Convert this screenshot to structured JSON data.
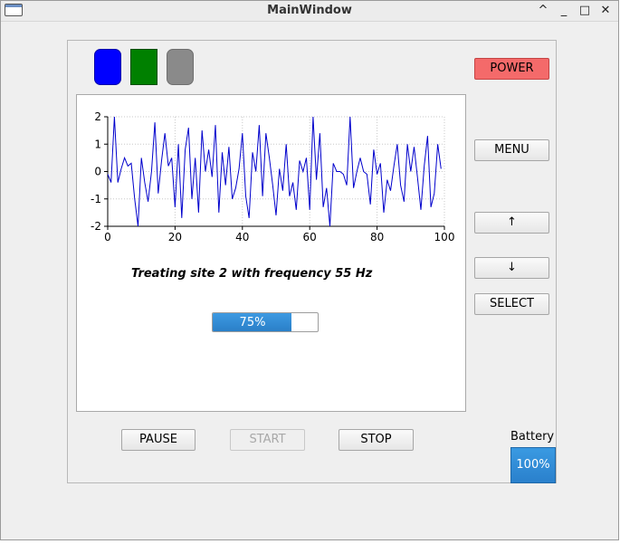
{
  "window": {
    "title": "MainWindow"
  },
  "titlebar_buttons": {
    "minimize_down": "^",
    "minimize": "_",
    "maximize": "□",
    "close": "✕"
  },
  "indicators": [
    {
      "name": "blue",
      "color": "#0000ff"
    },
    {
      "name": "green",
      "color": "#008000"
    },
    {
      "name": "gray",
      "color": "#8a8a8a"
    }
  ],
  "buttons": {
    "power": "POWER",
    "menu": "MENU",
    "up": "↑",
    "down": "↓",
    "select": "SELECT",
    "pause": "PAUSE",
    "start": "START",
    "stop": "STOP"
  },
  "status": {
    "treatment": "Treating site 2 with frequency 55 Hz",
    "progress_percent": 75,
    "progress_label": "75%"
  },
  "battery": {
    "label": "Battery",
    "value": "100%"
  },
  "chart_data": {
    "type": "line",
    "title": "",
    "xlabel": "",
    "ylabel": "",
    "xlim": [
      0,
      100
    ],
    "ylim": [
      -2,
      2
    ],
    "x_ticks": [
      "0",
      "20",
      "40",
      "60",
      "80",
      "100"
    ],
    "y_ticks": [
      "2",
      "1",
      "0",
      "-1",
      "-2"
    ],
    "grid": true,
    "line_color": "#0000cc",
    "series": [
      {
        "name": "",
        "x": [
          0,
          1,
          2,
          3,
          4,
          5,
          6,
          7,
          8,
          9,
          10,
          11,
          12,
          13,
          14,
          15,
          16,
          17,
          18,
          19,
          20,
          21,
          22,
          23,
          24,
          25,
          26,
          27,
          28,
          29,
          30,
          31,
          32,
          33,
          34,
          35,
          36,
          37,
          38,
          39,
          40,
          41,
          42,
          43,
          44,
          45,
          46,
          47,
          48,
          49,
          50,
          51,
          52,
          53,
          54,
          55,
          56,
          57,
          58,
          59,
          60,
          61,
          62,
          63,
          64,
          65,
          66,
          67,
          68,
          69,
          70,
          71,
          72,
          73,
          74,
          75,
          76,
          77,
          78,
          79,
          80,
          81,
          82,
          83,
          84,
          85,
          86,
          87,
          88,
          89,
          90,
          91,
          92,
          93,
          94,
          95,
          96,
          97,
          98,
          99
        ],
        "y": [
          -0.1,
          -0.4,
          2.0,
          -0.4,
          0.1,
          0.5,
          0.2,
          0.3,
          -1.0,
          -2.0,
          0.5,
          -0.4,
          -1.1,
          0.0,
          1.8,
          -0.8,
          0.4,
          1.4,
          0.2,
          0.5,
          -1.3,
          1.0,
          -1.7,
          0.8,
          1.6,
          -1.0,
          0.5,
          -1.5,
          1.5,
          0.0,
          0.8,
          -0.2,
          1.7,
          -1.5,
          0.7,
          -0.5,
          0.9,
          -1.0,
          -0.6,
          0.1,
          1.4,
          -0.9,
          -1.7,
          0.7,
          0.0,
          1.7,
          -0.9,
          1.4,
          0.5,
          -0.5,
          -1.6,
          0.1,
          -0.7,
          1.0,
          -0.9,
          -0.4,
          -1.4,
          0.4,
          0.0,
          0.5,
          -1.4,
          2.0,
          -0.3,
          1.4,
          -1.3,
          -0.6,
          -2.0,
          0.3,
          0.0,
          0.0,
          -0.1,
          -0.5,
          2.0,
          -0.6,
          0.0,
          0.5,
          0.0,
          -0.1,
          -1.2,
          0.8,
          -0.1,
          0.3,
          -1.5,
          -0.3,
          -0.7,
          0.2,
          1.0,
          -0.5,
          -1.1,
          1.0,
          0.0,
          0.9,
          -0.2,
          -1.4,
          0.2,
          1.3,
          -1.3,
          -0.8,
          1.0,
          0.1
        ]
      }
    ]
  }
}
